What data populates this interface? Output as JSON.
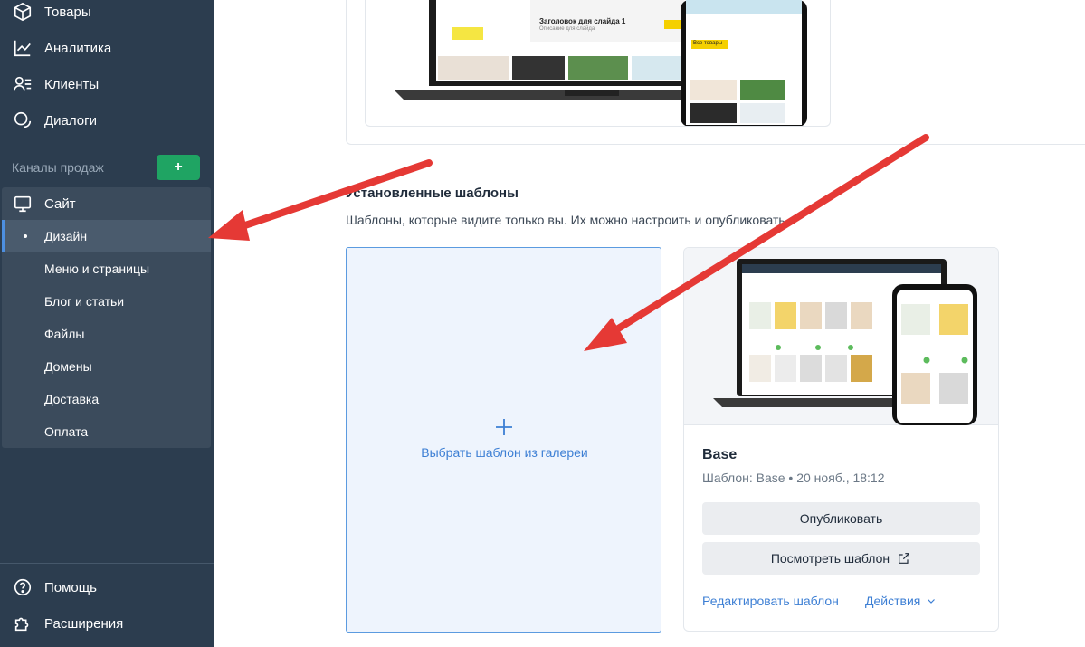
{
  "sidebar": {
    "items_top": [
      {
        "label": "Товары",
        "icon": "box-icon"
      },
      {
        "label": "Аналитика",
        "icon": "chart-line-icon"
      },
      {
        "label": "Клиенты",
        "icon": "clients-icon"
      },
      {
        "label": "Диалоги",
        "icon": "chat-icon"
      }
    ],
    "channels_label": "Каналы продаж",
    "add_channel_label": "+",
    "site": {
      "label": "Сайт",
      "icon": "monitor-icon"
    },
    "site_sub": [
      "Дизайн",
      "Меню и страницы",
      "Блог и статьи",
      "Файлы",
      "Домены",
      "Доставка",
      "Оплата"
    ],
    "active_sub": "Дизайн",
    "items_bottom": [
      {
        "label": "Помощь",
        "icon": "help-icon"
      },
      {
        "label": "Расширения",
        "icon": "puzzle-icon"
      }
    ]
  },
  "main": {
    "top_preview": {
      "slide_title": "Заголовок для слайда 1",
      "slide_sub": "Описание для слайда",
      "button": "Все товары"
    },
    "installed_title": "Установленные шаблоны",
    "installed_sub": "Шаблоны, которые видите только вы. Их можно настроить и опубликовать.",
    "gallery_label": "Выбрать шаблон из галереи",
    "template": {
      "name": "Base",
      "meta": "Шаблон: Base • 20 нояб., 18:12",
      "publish_label": "Опубликовать",
      "view_label": "Посмотреть шаблон",
      "edit_label": "Редактировать шаблон",
      "actions_label": "Действия"
    }
  },
  "colors": {
    "sidebar_bg": "#2c3d4f",
    "accent_green": "#1fa463",
    "link_blue": "#3d7fd4",
    "arrow_red": "#e53935"
  }
}
